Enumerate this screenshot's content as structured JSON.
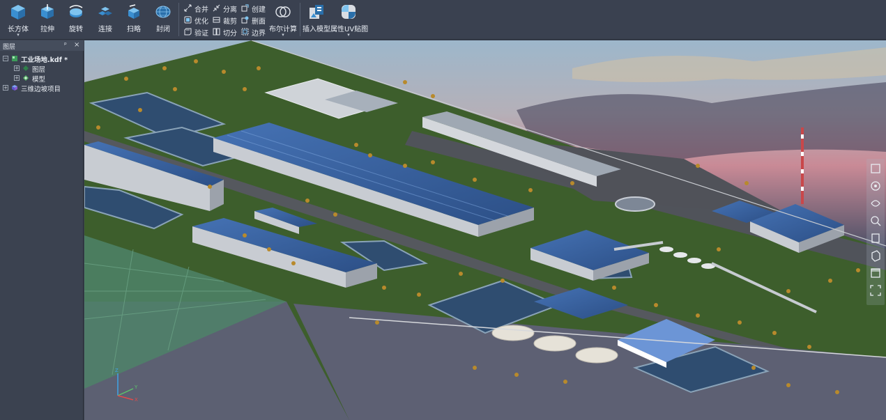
{
  "ribbon": {
    "modeling": [
      {
        "id": "box",
        "label": "长方体",
        "icon": "cube-icon",
        "has_dropdown": true
      },
      {
        "id": "extrude",
        "label": "拉伸",
        "icon": "extrude-icon",
        "has_dropdown": false
      },
      {
        "id": "revolve",
        "label": "旋转",
        "icon": "revolve-icon",
        "has_dropdown": false
      },
      {
        "id": "connect",
        "label": "连接",
        "icon": "connect-icon",
        "has_dropdown": false
      },
      {
        "id": "sweep",
        "label": "扫略",
        "icon": "sweep-icon",
        "has_dropdown": false
      },
      {
        "id": "close",
        "label": "封闭",
        "icon": "mesh-sphere-icon",
        "has_dropdown": false
      }
    ],
    "edit_tools": [
      {
        "id": "merge",
        "label": "合并",
        "icon": "merge-icon"
      },
      {
        "id": "separate",
        "label": "分离",
        "icon": "separate-icon"
      },
      {
        "id": "create",
        "label": "创建",
        "icon": "create-icon"
      },
      {
        "id": "optimize",
        "label": "优化",
        "icon": "optimize-icon"
      },
      {
        "id": "clip",
        "label": "裁剪",
        "icon": "clip-icon"
      },
      {
        "id": "delete_face",
        "label": "删面",
        "icon": "delete-face-icon"
      },
      {
        "id": "verify",
        "label": "验证",
        "icon": "verify-icon"
      },
      {
        "id": "split",
        "label": "切分",
        "icon": "split-icon"
      },
      {
        "id": "boundary",
        "label": "边界",
        "icon": "boundary-icon"
      }
    ],
    "boolean": {
      "label": "布尔计算",
      "icon": "boolean-icon",
      "has_dropdown": true
    },
    "insert_model": {
      "label": "插入模型",
      "icon": "insert-model-icon"
    },
    "uv_map": {
      "label": "属性UV贴图",
      "icon": "uv-map-icon",
      "has_dropdown": true
    },
    "dropdown_glyph": "▾"
  },
  "layers_panel": {
    "title": "图层",
    "pin_glyph": "ᵖ",
    "close_glyph": "×",
    "tree": [
      {
        "label": "工业场地.kdf *",
        "toggle": "−",
        "icon": "scene-file-icon",
        "depth": 0,
        "bold": true
      },
      {
        "label": "图层",
        "toggle": "+",
        "icon": "layer-icon",
        "depth": 1,
        "bold": false
      },
      {
        "label": "模型",
        "toggle": "+",
        "icon": "model-icon",
        "depth": 1,
        "bold": false
      },
      {
        "label": "三维边坡项目",
        "toggle": "+",
        "icon": "project-cube-icon",
        "depth": 0,
        "bold": false
      }
    ]
  },
  "viewport": {
    "scene": "3D industrial site model",
    "axis_labels": {
      "x": "X",
      "y": "Y",
      "z": "Z"
    },
    "nav_tools": [
      "select-icon",
      "orbit-icon",
      "pan-rotate-icon",
      "zoom-icon",
      "view-front-icon",
      "view-iso-icon",
      "view-top-icon",
      "fit-extent-icon"
    ],
    "colors": {
      "sky_top": "#9fb7c9",
      "sky_glow": "#c98a96",
      "grass": "#3d5e2c",
      "road": "#4a4d55",
      "ground": "#5c6072",
      "roof": "#3a64a6",
      "water": "#2f4d70"
    }
  }
}
